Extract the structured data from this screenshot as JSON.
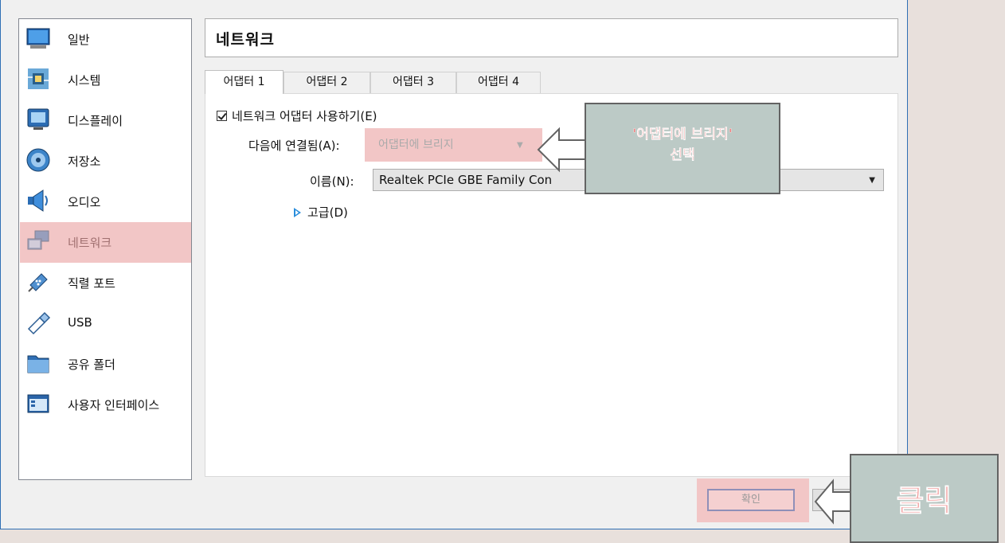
{
  "sidebar": {
    "items": [
      {
        "label": "일반",
        "icon": "monitor-icon"
      },
      {
        "label": "시스템",
        "icon": "chip-icon"
      },
      {
        "label": "디스플레이",
        "icon": "display-icon"
      },
      {
        "label": "저장소",
        "icon": "disk-icon"
      },
      {
        "label": "오디오",
        "icon": "speaker-icon"
      },
      {
        "label": "네트워크",
        "icon": "network-icon"
      },
      {
        "label": "직렬 포트",
        "icon": "serial-port-icon"
      },
      {
        "label": "USB",
        "icon": "usb-icon"
      },
      {
        "label": "공유 폴더",
        "icon": "folder-icon"
      },
      {
        "label": "사용자 인터페이스",
        "icon": "ui-window-icon"
      }
    ],
    "selected": "네트워크"
  },
  "page": {
    "title": "네트워크"
  },
  "tabs": [
    "어댑터 1",
    "어댑터 2",
    "어댑터 3",
    "어댑터 4"
  ],
  "form": {
    "enable_label": "네트워크 어댑터 사용하기(E)",
    "attached_label": "다음에 연결됨(A):",
    "attached_value": "어댑터에 브리지",
    "name_label": "이름(N):",
    "name_value": "Realtek PCIe GBE Family Con",
    "advanced_label": "고급(D)"
  },
  "buttons": {
    "ok": "확인"
  },
  "annotations": {
    "callout_attach_line1": "'어댑터에 브리지'",
    "callout_attach_line2": "선택",
    "callout_click": "클릭",
    "highlight_color": "#f2c6c6",
    "callout_bg": "#bccac6",
    "callout_text_color": "#f08080"
  }
}
